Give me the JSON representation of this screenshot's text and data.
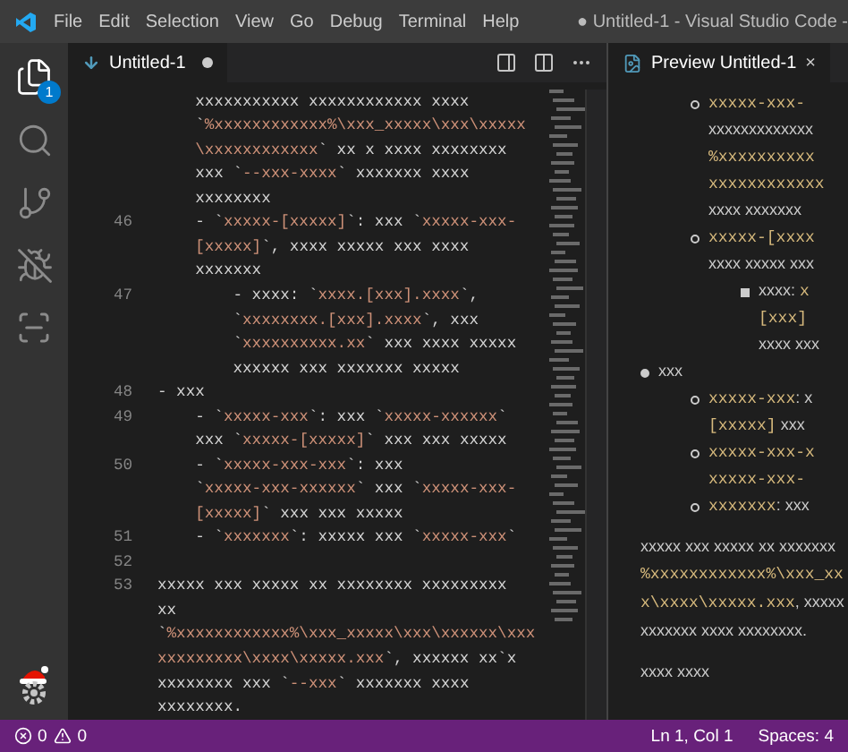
{
  "window": {
    "title": "● Untitled-1 - Visual Studio Code -"
  },
  "menu": [
    "File",
    "Edit",
    "Selection",
    "View",
    "Go",
    "Debug",
    "Terminal",
    "Help"
  ],
  "activity_bar": {
    "badge": "1"
  },
  "editor": {
    "tab": {
      "label": "Untitled-1",
      "selected": true,
      "dirty": true
    },
    "lines": [
      {
        "segments": [
          {
            "kind": "text",
            "text": "    xxxxxxxxxxx xxxxxxxxxxxx xxxx"
          }
        ]
      },
      {
        "segments": [
          {
            "kind": "text",
            "text": "    `"
          },
          {
            "kind": "code",
            "text": "%xxxxxxxxxxxx%\\xxx_xxxxx\\xxx\\xxxxx"
          }
        ]
      },
      {
        "segments": [
          {
            "kind": "code",
            "text": "    \\xxxxxxxxxxxx"
          },
          {
            "kind": "text",
            "text": "` xx x xxxx xxxxxxxx"
          }
        ]
      },
      {
        "segments": [
          {
            "kind": "text",
            "text": "    xxx `"
          },
          {
            "kind": "code",
            "text": "--xxx-xxxx"
          },
          {
            "kind": "text",
            "text": "` xxxxxxx xxxx"
          }
        ]
      },
      {
        "segments": [
          {
            "kind": "text",
            "text": "    xxxxxxxx"
          }
        ]
      },
      {
        "number": "46",
        "segments": [
          {
            "kind": "text",
            "text": "    - `"
          },
          {
            "kind": "code",
            "text": "xxxxx-[xxxxx]"
          },
          {
            "kind": "text",
            "text": "`: xxx `"
          },
          {
            "kind": "code",
            "text": "xxxxx-xxx-"
          }
        ]
      },
      {
        "segments": [
          {
            "kind": "code",
            "text": "    [xxxxx]"
          },
          {
            "kind": "text",
            "text": "`, xxxx xxxxx xxx xxxx"
          }
        ]
      },
      {
        "segments": [
          {
            "kind": "text",
            "text": "    xxxxxxx"
          }
        ]
      },
      {
        "number": "47",
        "segments": [
          {
            "kind": "text",
            "text": "        - xxxx: `"
          },
          {
            "kind": "code",
            "text": "xxxx.[xxx].xxxx"
          },
          {
            "kind": "text",
            "text": "`,"
          }
        ]
      },
      {
        "segments": [
          {
            "kind": "text",
            "text": "        `"
          },
          {
            "kind": "code",
            "text": "xxxxxxxx.[xxx].xxxx"
          },
          {
            "kind": "text",
            "text": "`, xxx"
          }
        ]
      },
      {
        "segments": [
          {
            "kind": "text",
            "text": "        `"
          },
          {
            "kind": "code",
            "text": "xxxxxxxxxx.xx"
          },
          {
            "kind": "text",
            "text": "` xxx xxxx xxxxx"
          }
        ]
      },
      {
        "segments": [
          {
            "kind": "text",
            "text": "        xxxxxx xxx xxxxxxx xxxxx"
          }
        ]
      },
      {
        "number": "48",
        "segments": [
          {
            "kind": "text",
            "text": "- xxx"
          }
        ]
      },
      {
        "number": "49",
        "segments": [
          {
            "kind": "text",
            "text": "    - `"
          },
          {
            "kind": "code",
            "text": "xxxxx-xxx"
          },
          {
            "kind": "text",
            "text": "`: xxx `"
          },
          {
            "kind": "code",
            "text": "xxxxx-xxxxxx"
          },
          {
            "kind": "text",
            "text": "`"
          }
        ]
      },
      {
        "segments": [
          {
            "kind": "text",
            "text": "    xxx `"
          },
          {
            "kind": "code",
            "text": "xxxxx-[xxxxx]"
          },
          {
            "kind": "text",
            "text": "` xxx xxx xxxxx"
          }
        ]
      },
      {
        "number": "50",
        "segments": [
          {
            "kind": "text",
            "text": "    - `"
          },
          {
            "kind": "code",
            "text": "xxxxx-xxx-xxx"
          },
          {
            "kind": "text",
            "text": "`: xxx"
          }
        ]
      },
      {
        "segments": [
          {
            "kind": "text",
            "text": "    `"
          },
          {
            "kind": "code",
            "text": "xxxxx-xxx-xxxxxx"
          },
          {
            "kind": "text",
            "text": "` xxx `"
          },
          {
            "kind": "code",
            "text": "xxxxx-xxx-"
          }
        ]
      },
      {
        "segments": [
          {
            "kind": "code",
            "text": "    [xxxxx]"
          },
          {
            "kind": "text",
            "text": "` xxx xxx xxxxx"
          }
        ]
      },
      {
        "number": "51",
        "segments": [
          {
            "kind": "text",
            "text": "    - `"
          },
          {
            "kind": "code",
            "text": "xxxxxxx"
          },
          {
            "kind": "text",
            "text": "`: xxxxx xxx `"
          },
          {
            "kind": "code",
            "text": "xxxxx-xxx"
          },
          {
            "kind": "text",
            "text": "`"
          }
        ]
      },
      {
        "number": "52"
      },
      {
        "number": "53",
        "segments": [
          {
            "kind": "text",
            "text": "xxxxx xxx xxxxx xx xxxxxxxx xxxxxxxxx"
          }
        ]
      },
      {
        "segments": [
          {
            "kind": "text",
            "text": "xx"
          }
        ]
      },
      {
        "segments": [
          {
            "kind": "text",
            "text": "`"
          },
          {
            "kind": "code",
            "text": "%xxxxxxxxxxxx%\\xxx_xxxxx\\xxx\\xxxxxx\\xxx"
          }
        ]
      },
      {
        "segments": [
          {
            "kind": "code",
            "text": "xxxxxxxxx\\xxxx\\xxxxx.xxx"
          },
          {
            "kind": "text",
            "text": "`, xxxxxx xx`x"
          }
        ]
      },
      {
        "segments": [
          {
            "kind": "text",
            "text": "xxxxxxxx xxx `"
          },
          {
            "kind": "code",
            "text": "--xxx"
          },
          {
            "kind": "text",
            "text": "` xxxxxxx xxxx"
          }
        ]
      },
      {
        "segments": [
          {
            "kind": "text",
            "text": "xxxxxxxx."
          }
        ]
      }
    ]
  },
  "preview": {
    "tab": {
      "label": "Preview Untitled-1",
      "selected": true,
      "close": "×"
    },
    "items": [
      {
        "children": [
          {
            "kind": "circle",
            "lines": [
              [
                {
                  "kind": "code",
                  "text": "xxxxx-xxx-"
                }
              ],
              [
                {
                  "kind": "text",
                  "text": "xxxxxxxxxxxxx"
                }
              ],
              [
                {
                  "kind": "code",
                  "text": "%xxxxxxxxxx"
                }
              ],
              [
                {
                  "kind": "code",
                  "text": "xxxxxxxxxxxx"
                }
              ],
              [
                {
                  "kind": "text",
                  "text": "xxxx xxxxxxx"
                }
              ]
            ]
          },
          {
            "kind": "circle",
            "lines": [
              [
                {
                  "kind": "code",
                  "text": "xxxxx-[xxxx"
                }
              ],
              [
                {
                  "kind": "text",
                  "text": "xxxx xxxxx xxx"
                }
              ]
            ],
            "children": [
              {
                "kind": "square",
                "lines": [
                  [
                    {
                      "kind": "text",
                      "text": "xxxx: "
                    },
                    {
                      "kind": "code",
                      "text": "x"
                    }
                  ],
                  [
                    {
                      "kind": "code",
                      "text": "[xxx]"
                    }
                  ],
                  [
                    {
                      "kind": "text",
                      "text": "xxxx xxx"
                    }
                  ]
                ]
              }
            ]
          }
        ]
      },
      {
        "kind": "disc",
        "lines": [
          [
            {
              "kind": "text",
              "text": "xxx"
            }
          ]
        ],
        "children": [
          {
            "kind": "circle",
            "lines": [
              [
                {
                  "kind": "code",
                  "text": "xxxxx-xxx"
                },
                {
                  "kind": "text",
                  "text": ": x"
                }
              ],
              [
                {
                  "kind": "code",
                  "text": "[xxxxx]"
                },
                {
                  "kind": "text",
                  "text": " xxx"
                }
              ]
            ]
          },
          {
            "kind": "circle",
            "lines": [
              [
                {
                  "kind": "code",
                  "text": "xxxxx-xxx-x"
                }
              ],
              [
                {
                  "kind": "code",
                  "text": "xxxxx-xxx-"
                }
              ]
            ]
          },
          {
            "kind": "circle",
            "lines": [
              [
                {
                  "kind": "code",
                  "text": "xxxxxxx"
                },
                {
                  "kind": "text",
                  "text": ": xxx"
                }
              ]
            ]
          }
        ]
      }
    ],
    "paragraphs": [
      [
        [
          {
            "kind": "text",
            "text": "xxxxx xxx xxxxx xx xxxxxxx"
          }
        ],
        [
          {
            "kind": "code",
            "text": "%xxxxxxxxxxxx%\\xxx_xx"
          }
        ],
        [
          {
            "kind": "code",
            "text": "x\\xxxx\\xxxxx.xxx"
          },
          {
            "kind": "text",
            "text": ", xxxxx"
          }
        ],
        [
          {
            "kind": "text",
            "text": "xxxxxxx xxxx xxxxxxxx."
          }
        ]
      ],
      [
        [
          {
            "kind": "text",
            "text": "xxxx xxxx"
          }
        ]
      ]
    ]
  },
  "status_bar": {
    "errors": "0",
    "warnings": "0",
    "position": "Ln 1, Col 1",
    "indent": "Spaces: 4"
  }
}
